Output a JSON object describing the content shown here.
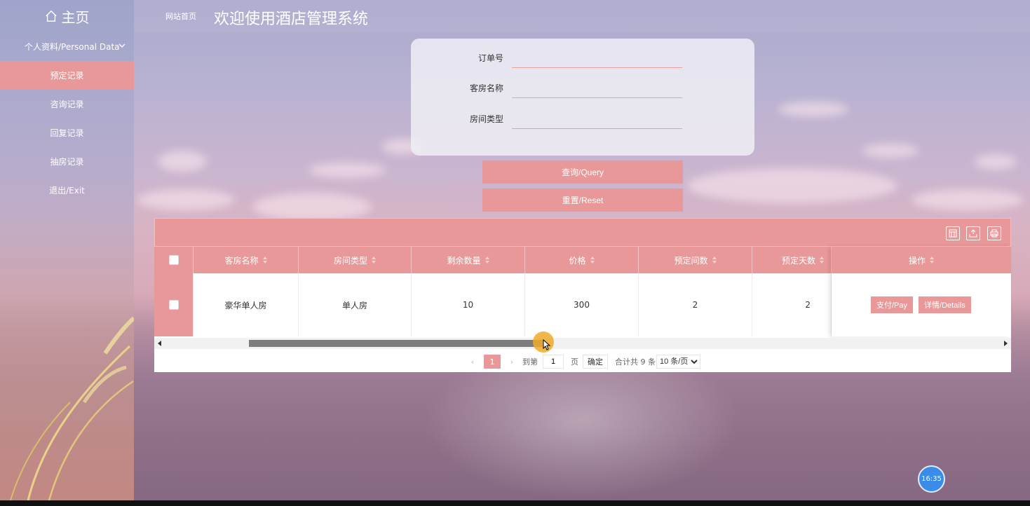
{
  "sidebar": {
    "home_label": "主页",
    "items": [
      {
        "label": "个人资料/Personal Data"
      },
      {
        "label": "预定记录"
      },
      {
        "label": "咨询记录"
      },
      {
        "label": "回复记录"
      },
      {
        "label": "抽房记录"
      },
      {
        "label": "退出/Exit"
      }
    ]
  },
  "header": {
    "breadcrumb": "网站首页",
    "title": "欢迎使用酒店管理系统"
  },
  "search": {
    "order_label": "订单号",
    "room_name_label": "客房名称",
    "room_type_label": "房间类型",
    "query_button": "查询/Query",
    "reset_button": "重置/Reset"
  },
  "table": {
    "columns": [
      "客房名称",
      "房间类型",
      "剩余数量",
      "价格",
      "预定间数",
      "预定天数",
      "操作"
    ],
    "rows": [
      {
        "room_name": "豪华单人房",
        "room_type": "单人房",
        "remaining": "10",
        "price": "300",
        "rooms_booked": "2",
        "days_booked": "2",
        "pay_label": "支付/Pay",
        "details_label": "详情/Details"
      }
    ]
  },
  "pager": {
    "current_page": "1",
    "goto_label": "到第",
    "goto_value": "1",
    "page_unit": "页",
    "confirm_label": "确定",
    "total_label": "合计共 9 条",
    "page_size": "10 条/页"
  },
  "clock": "16:35",
  "colors": {
    "accent": "#e89898",
    "clock": "#3b8be8"
  }
}
